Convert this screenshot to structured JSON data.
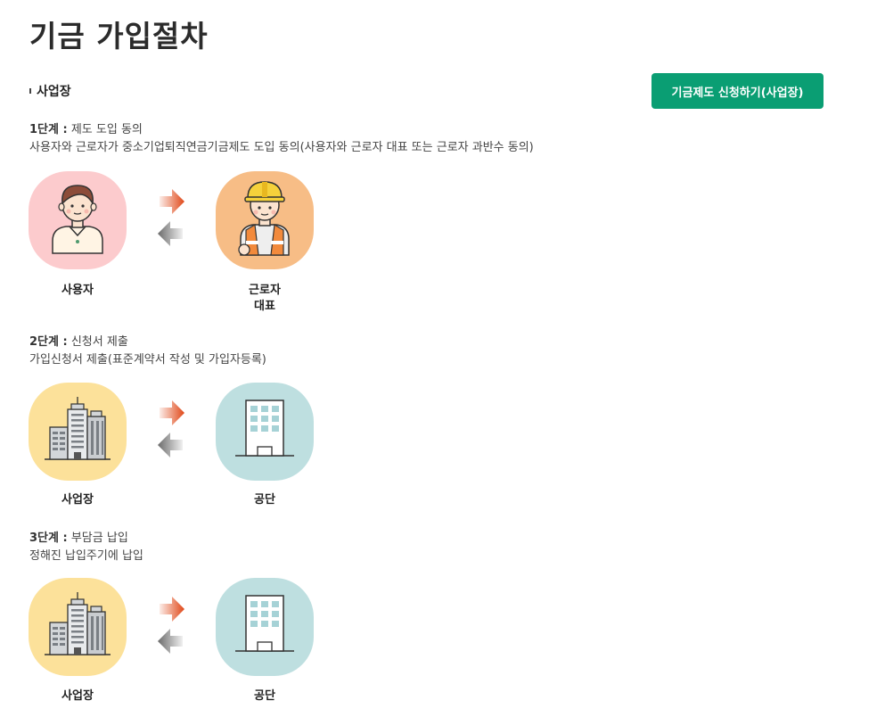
{
  "page": {
    "title": "기금 가입절차"
  },
  "section": {
    "label": "사업장",
    "apply_button": "기금제도 신청하기(사업장)"
  },
  "steps": [
    {
      "step_label": "1단계 :",
      "step_name": "제도 도입 동의",
      "description": "사용자와 근로자가 중소기업퇴직연금기금제도 도입 동의(사용자와 근로자 대표 또는 근로자 과반수 동의)",
      "left_caption": "사용자",
      "right_caption_line1": "근로자",
      "right_caption_line2": "대표",
      "left_icon": "employer-person-icon",
      "right_icon": "worker-hardhat-icon"
    },
    {
      "step_label": "2단계 :",
      "step_name": "신청서 제출",
      "description": "가입신청서 제출(표준계약서 작성 및 가입자등록)",
      "left_caption": "사업장",
      "right_caption": "공단",
      "left_icon": "workplace-buildings-icon",
      "right_icon": "agency-building-icon"
    },
    {
      "step_label": "3단계 :",
      "step_name": "부담금 납입",
      "description": "정해진 납입주기에 납입",
      "left_caption": "사업장",
      "right_caption": "공단",
      "left_icon": "workplace-buildings-icon",
      "right_icon": "agency-building-icon"
    }
  ],
  "colors": {
    "button_green": "#0a9e73",
    "arrow_red": "#e04818",
    "arrow_gray": "#6b6b6b",
    "pink_bg": "#fccbcd",
    "orange_bg": "#f7bd86",
    "yellow_bg": "#fce19a",
    "teal_bg": "#bedfe0"
  }
}
